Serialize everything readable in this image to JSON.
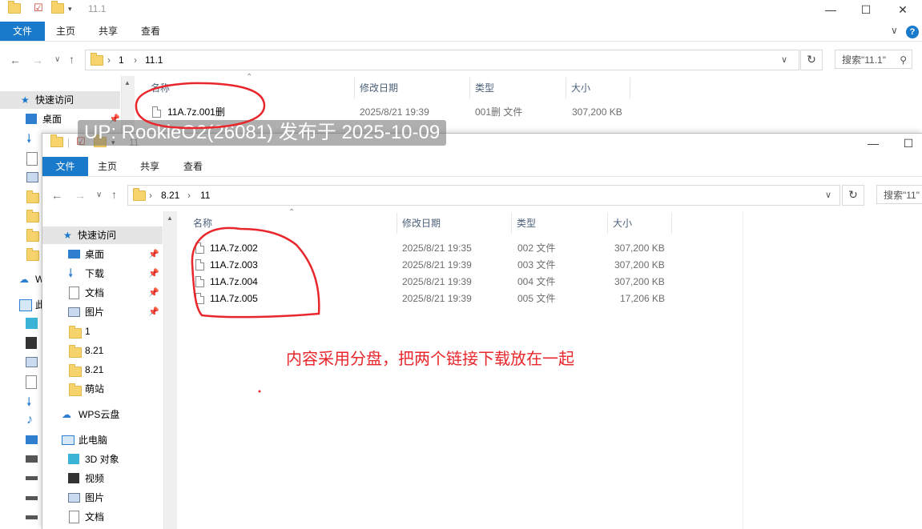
{
  "back_window": {
    "title": "11.1",
    "ribbon": {
      "file": "文件",
      "home": "主页",
      "share": "共享",
      "view": "查看"
    },
    "crumbs": [
      "1",
      "11.1"
    ],
    "search_placeholder": "搜索\"11.1\"",
    "columns": {
      "name": "名称",
      "date": "修改日期",
      "type": "类型",
      "size": "大小"
    },
    "quick_access": "快速访问",
    "nav_partial": {
      "desktop": "桌面",
      "wps": "W",
      "pc": "此"
    },
    "files": [
      {
        "name": "11A.7z.001删",
        "date": "2025/8/21 19:39",
        "type": "001删 文件",
        "size": "307,200 KB"
      }
    ]
  },
  "front_window": {
    "title": "11",
    "ribbon": {
      "file": "文件",
      "home": "主页",
      "share": "共享",
      "view": "查看"
    },
    "crumbs": [
      "8.21",
      "11"
    ],
    "search_placeholder": "搜索\"11\"",
    "columns": {
      "name": "名称",
      "date": "修改日期",
      "type": "类型",
      "size": "大小"
    },
    "nav": {
      "quick_access": "快速访问",
      "items": [
        "桌面",
        "下载",
        "文档",
        "图片",
        "1",
        "8.21",
        "8.21",
        "萌站"
      ],
      "wps": "WPS云盘",
      "this_pc": "此电脑",
      "pc_items": [
        "3D 对象",
        "视频",
        "图片",
        "文档"
      ]
    },
    "files": [
      {
        "name": "11A.7z.002",
        "date": "2025/8/21 19:35",
        "type": "002 文件",
        "size": "307,200 KB"
      },
      {
        "name": "11A.7z.003",
        "date": "2025/8/21 19:39",
        "type": "003 文件",
        "size": "307,200 KB"
      },
      {
        "name": "11A.7z.004",
        "date": "2025/8/21 19:39",
        "type": "004 文件",
        "size": "307,200 KB"
      },
      {
        "name": "11A.7z.005",
        "date": "2025/8/21 19:39",
        "type": "005 文件",
        "size": "17,206 KB"
      }
    ]
  },
  "watermark": "UP: RookieO2(26081) 发布于 2025-10-09",
  "annotation": "内容采用分盘，把两个链接下载放在一起",
  "colors": {
    "accent": "#1979ca",
    "annotation_red": "#e8262b",
    "folder": "#f6d36b"
  }
}
